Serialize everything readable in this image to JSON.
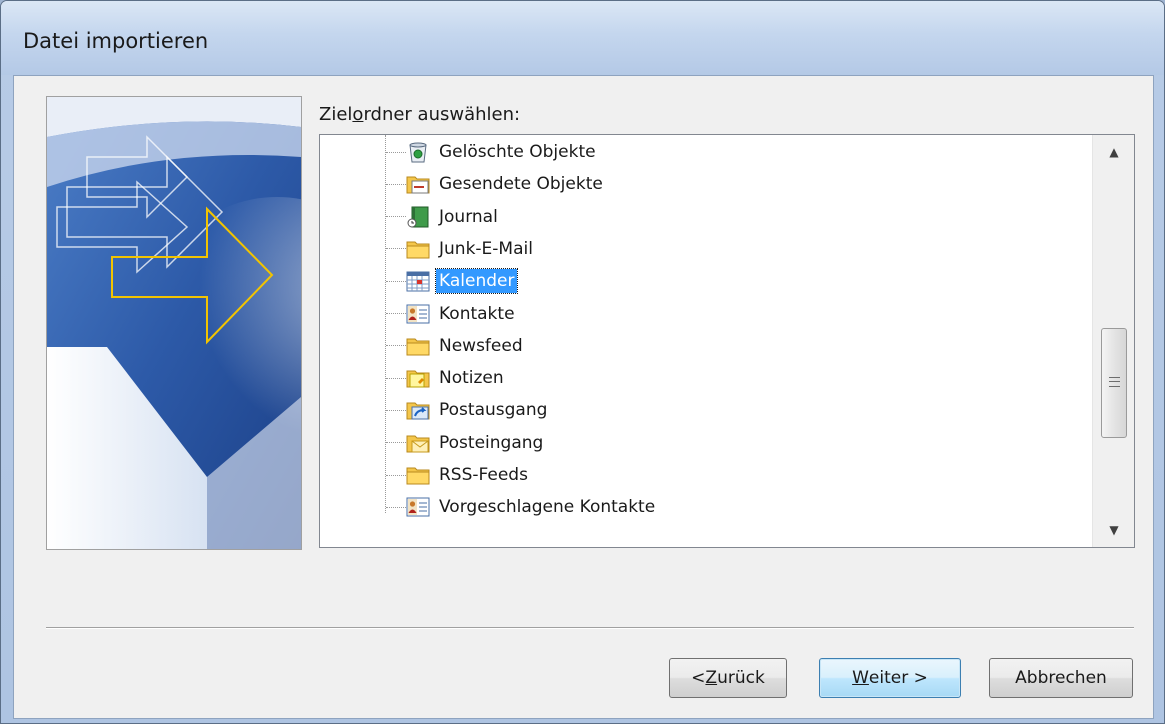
{
  "window": {
    "title": "Datei importieren"
  },
  "folder_picker": {
    "label_prefix": "Ziel",
    "label_hotkey": "o",
    "label_suffix": "rdner auswählen:",
    "selected": "Kalender",
    "items": [
      {
        "label": "Gelöschte Objekte",
        "icon": "deleted-items-icon"
      },
      {
        "label": "Gesendete Objekte",
        "icon": "sent-items-icon"
      },
      {
        "label": "Journal",
        "icon": "journal-icon"
      },
      {
        "label": "Junk-E-Mail",
        "icon": "folder-icon"
      },
      {
        "label": "Kalender",
        "icon": "calendar-icon"
      },
      {
        "label": "Kontakte",
        "icon": "contacts-icon"
      },
      {
        "label": "Newsfeed",
        "icon": "folder-icon"
      },
      {
        "label": "Notizen",
        "icon": "notes-icon"
      },
      {
        "label": "Postausgang",
        "icon": "outbox-icon"
      },
      {
        "label": "Posteingang",
        "icon": "inbox-icon"
      },
      {
        "label": "RSS-Feeds",
        "icon": "folder-icon"
      },
      {
        "label": "Vorgeschlagene Kontakte",
        "icon": "contacts-icon"
      }
    ]
  },
  "scrollbar": {
    "position_fraction": 0.68
  },
  "buttons": {
    "back_prefix": "< ",
    "back_hotkey": "Z",
    "back_suffix": "urück",
    "next_hotkey": "W",
    "next_suffix": "eiter >",
    "cancel": "Abbrechen"
  },
  "colors": {
    "selection": "#3399ff",
    "banner_blue": "#2d5aa8",
    "arrow_yellow": "#f2c400"
  }
}
